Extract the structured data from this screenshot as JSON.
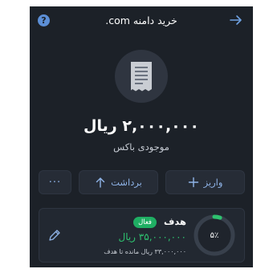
{
  "header": {
    "title": "خرید دامنه com.",
    "help_glyph": "?",
    "back_icon": "arrow-right-icon",
    "help_icon": "question-circle-icon"
  },
  "wallet": {
    "icon": "receipt-icon",
    "balance": "۲,۰۰۰,۰۰۰ ریال",
    "balance_label": "موجودی باکس"
  },
  "actions": {
    "more_label": "···",
    "withdraw_label": "برداشت",
    "deposit_label": "واریز",
    "withdraw_icon": "arrow-up-icon",
    "deposit_icon": "plus-icon"
  },
  "goal": {
    "title": "هدف",
    "status_badge": "فعال",
    "amount": "۳۵,۰۰۰,۰۰۰ ریال",
    "remaining": "۳۳,۰۰۰,۰۰۰ ریال مانده تا هدف",
    "progress_label": "۵٪",
    "progress_percent": 5,
    "edit_icon": "pencil-icon"
  },
  "colors": {
    "background": "#1c2128",
    "accent": "#6ea0e0",
    "success": "#1fae63"
  }
}
